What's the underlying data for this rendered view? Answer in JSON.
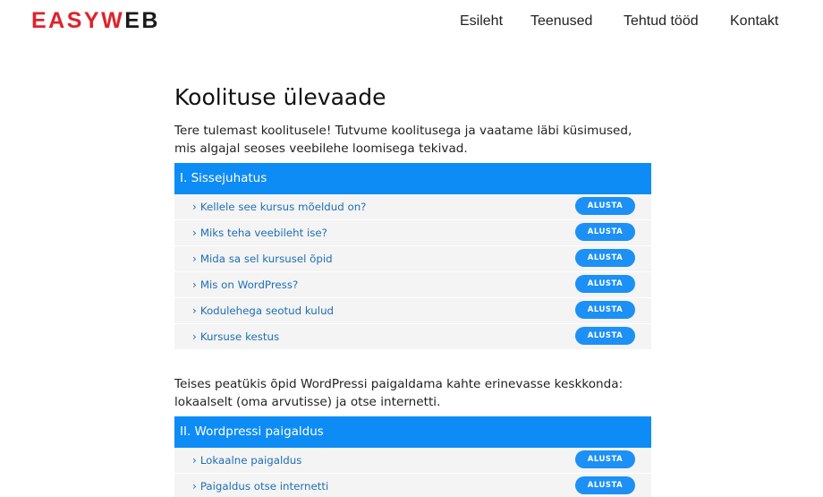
{
  "logo": {
    "part1": "EASY",
    "part2": "W",
    "part3": "EB"
  },
  "nav": {
    "home": "Esileht",
    "services": "Teenused",
    "works": "Tehtud tööd",
    "contact": "Kontakt"
  },
  "page_title": "Koolituse ülevaade",
  "intro_text": "Tere tulemast koolitusele! Tutvume koolitusega ja vaatame läbi küsimused, mis algajal seoses veebilehe loomisega tekivad.",
  "sections": [
    {
      "title": "I. Sissejuhatus",
      "items": [
        {
          "label": "Kellele see kursus mõeldud on?",
          "button": "ALUSTA"
        },
        {
          "label": "Miks teha veebileht ise?",
          "button": "ALUSTA"
        },
        {
          "label": "Mida sa sel kursusel õpid",
          "button": "ALUSTA"
        },
        {
          "label": "Mis on WordPress?",
          "button": "ALUSTA"
        },
        {
          "label": "Kodulehega seotud kulud",
          "button": "ALUSTA"
        },
        {
          "label": "Kursuse kestus",
          "button": "ALUSTA"
        }
      ]
    },
    {
      "intro": "Teises peatükis õpid WordPressi paigaldama kahte erinevasse keskkonda: lokaalselt (oma arvutisse) ja otse internetti.",
      "title": "II. Wordpressi paigaldus",
      "items": [
        {
          "label": "Lokaalne paigaldus",
          "button": "ALUSTA"
        },
        {
          "label": "Paigaldus otse internetti",
          "button": "ALUSTA"
        }
      ]
    }
  ]
}
